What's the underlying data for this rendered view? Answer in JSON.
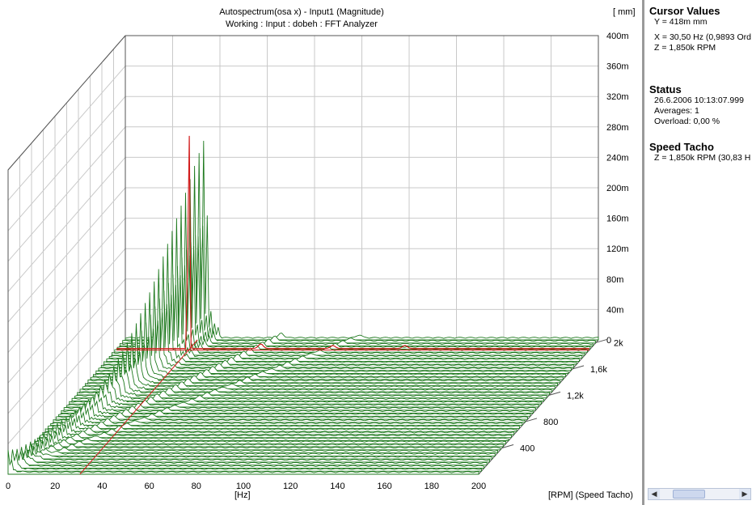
{
  "chart_data": {
    "type": "waterfall",
    "title": "Autospectrum(osa x) - Input1 (Magnitude)",
    "subtitle": "Working : Input : dobeh : FFT Analyzer",
    "xlabel": "[Hz]",
    "ylabel": "[ mm]",
    "zlabel": "[RPM] (Speed Tacho)",
    "xlim": [
      0,
      200
    ],
    "ylim": [
      0,
      0.4
    ],
    "zlim": [
      0,
      2000
    ],
    "x_ticks": [
      "0",
      "20",
      "40",
      "60",
      "80",
      "100",
      "120",
      "140",
      "160",
      "180",
      "200"
    ],
    "y_ticks": [
      "0",
      "40m",
      "80m",
      "120m",
      "160m",
      "200m",
      "240m",
      "280m",
      "320m",
      "360m",
      "400m"
    ],
    "z_ticks": [
      "400",
      "800",
      "1,2k",
      "1,6k",
      "2k"
    ],
    "grid": true,
    "series_color": "#1f7a1f",
    "cursor_color": "#d21d1d",
    "peak": {
      "x_hz": 30.5,
      "z_rpm": 1850,
      "y_mm": 0.418
    },
    "n_slices": 45
  },
  "panel": {
    "cursor": {
      "title": "Cursor Values",
      "y": "Y = 418m  mm",
      "x": "X = 30,50 Hz  (0,9893 Ord",
      "z": "Z = 1,850k RPM"
    },
    "status": {
      "title": "Status",
      "datetime": "26.6.2006  10:13:07.999",
      "averages": "Averages: 1",
      "overload": "Overload:   0,00 %"
    },
    "tacho": {
      "title": "Speed Tacho",
      "value": "Z = 1,850k RPM (30,83 H"
    }
  }
}
